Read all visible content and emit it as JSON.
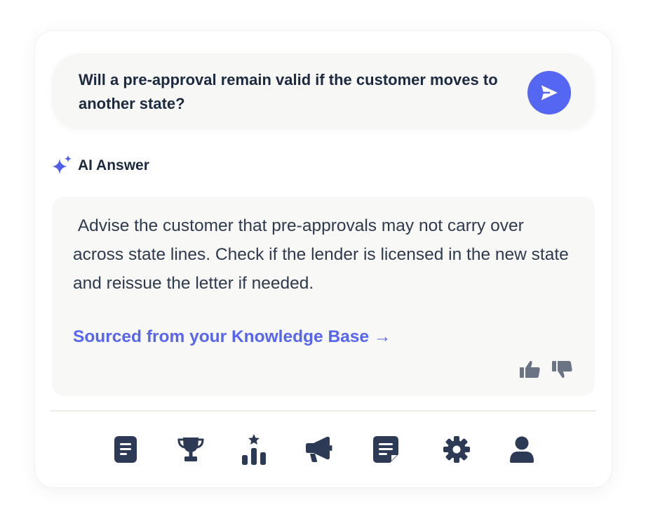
{
  "question": {
    "text": "Will a pre-approval remain valid if the customer moves to another state?",
    "send_icon": "send-icon"
  },
  "answer_header": {
    "icon": "sparkle-icon",
    "label": "AI Answer"
  },
  "answer": {
    "text": " Advise the customer that pre-approvals may not carry over across state lines. Check if the lender is licensed in the new state and reissue the letter if needed.",
    "source_link": "Sourced from your Knowledge Base →"
  },
  "feedback": {
    "icons": [
      "thumbs-up-icon",
      "thumbs-down-icon"
    ]
  },
  "nav": {
    "icons": [
      "document-icon",
      "trophy-icon",
      "leaderboard-icon",
      "megaphone-icon",
      "notes-icon",
      "settings-icon",
      "user-icon"
    ]
  },
  "colors": {
    "accent": "#5566f2",
    "text_dark": "#1c2a40",
    "icon": "#2c3a55",
    "feedback_icon": "#6b7484"
  }
}
